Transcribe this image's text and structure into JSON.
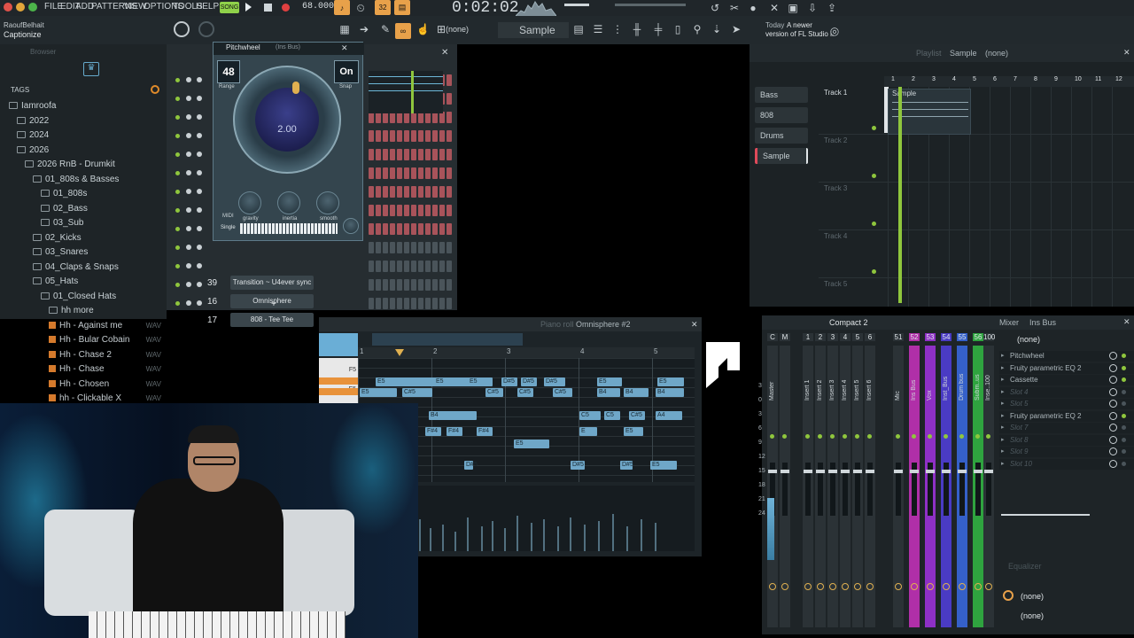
{
  "menu": [
    "FILE",
    "EDIT",
    "ADD",
    "PATTERNS",
    "VIEW",
    "OPTIONS",
    "TOOLS",
    "HELP"
  ],
  "transport": {
    "mode": "SONG",
    "tempo": "68.000",
    "time": "0:02:02",
    "step": "32"
  },
  "user": {
    "name": "RaoufBelhait",
    "sub": "Captionize"
  },
  "toolbar": {
    "preset": "(none)",
    "pattern": "Sample"
  },
  "news": {
    "line1": "Today",
    "line1b": "A newer",
    "line2": "version of FL Studio i."
  },
  "browser": {
    "search_placeholder": "Browser",
    "tags_label": "TAGS",
    "tree": [
      {
        "label": "Iamroofa",
        "level": 0,
        "type": "folder"
      },
      {
        "label": "2022",
        "level": 1,
        "type": "folder"
      },
      {
        "label": "2024",
        "level": 1,
        "type": "folder"
      },
      {
        "label": "2026",
        "level": 1,
        "type": "folder"
      },
      {
        "label": "2026 RnB - Drumkit",
        "level": 2,
        "type": "folder"
      },
      {
        "label": "01_808s & Basses",
        "level": 3,
        "type": "folder"
      },
      {
        "label": "01_808s",
        "level": 4,
        "type": "folder"
      },
      {
        "label": "02_Bass",
        "level": 4,
        "type": "folder"
      },
      {
        "label": "03_Sub",
        "level": 4,
        "type": "folder"
      },
      {
        "label": "02_Kicks",
        "level": 3,
        "type": "folder"
      },
      {
        "label": "03_Snares",
        "level": 3,
        "type": "folder"
      },
      {
        "label": "04_Claps & Snaps",
        "level": 3,
        "type": "folder"
      },
      {
        "label": "05_Hats",
        "level": 3,
        "type": "folder"
      },
      {
        "label": "01_Closed Hats",
        "level": 4,
        "type": "folder"
      },
      {
        "label": "hh more",
        "level": 5,
        "type": "folder"
      },
      {
        "label": "Hh - Against me",
        "level": 5,
        "type": "wav"
      },
      {
        "label": "Hh - Bular Cobain",
        "level": 5,
        "type": "wav"
      },
      {
        "label": "Hh - Chase 2",
        "level": 5,
        "type": "wav"
      },
      {
        "label": "Hh - Chase",
        "level": 5,
        "type": "wav"
      },
      {
        "label": "Hh - Chosen",
        "level": 5,
        "type": "wav"
      },
      {
        "label": "hh - Clickable X",
        "level": 5,
        "type": "wav"
      }
    ],
    "wav_tag": "WAV"
  },
  "pitchwheel": {
    "title": "Pitchwheel",
    "subtitle": "(Ins Bus)",
    "range_value": "48",
    "range_label": "Range",
    "snap_value": "On",
    "snap_label": "Snap",
    "center_value": "2.00",
    "knobs": [
      "gravity",
      "inertia",
      "smooth"
    ],
    "mode": "Single",
    "midi": "MIDI"
  },
  "channels": [
    {
      "num": "39",
      "name": "Transition ~ U4ever sync"
    },
    {
      "num": "16",
      "name": "Omnisphere"
    },
    {
      "num": "17",
      "name": "808 - Tee Tee"
    }
  ],
  "pianoroll": {
    "title": "Piano roll",
    "instrument": "Omnisphere #2",
    "bars": [
      "1",
      "2",
      "3",
      "4",
      "5"
    ],
    "keys": [
      "F5",
      "E5",
      "D5"
    ],
    "notes": [
      "E5",
      "E5",
      "E5",
      "D#5",
      "D#5",
      "D#5",
      "E5",
      "E5",
      "E5",
      "C#5",
      "C#5",
      "C#5",
      "C#5",
      "B4",
      "B4",
      "B4",
      "B4",
      "C5",
      "C5",
      "C#5",
      "A4",
      "A4",
      "G#4",
      "F#4",
      "F#4",
      "F#4",
      "E"
    ]
  },
  "playlist": {
    "title": "Playlist",
    "arrangement": "Sample",
    "pattern": "(none)",
    "patterns": [
      "Bass",
      "808",
      "Drums",
      "Sample"
    ],
    "tracks": [
      "Track 1",
      "Track 2",
      "Track 3",
      "Track 4",
      "Track 5"
    ],
    "clip_label": "Sample",
    "ruler": [
      "1",
      "2",
      "3",
      "4",
      "5",
      "6",
      "7",
      "8",
      "9",
      "10",
      "11",
      "12"
    ]
  },
  "mixer": {
    "title": "Mixer",
    "subtitle": "Ins Bus",
    "layout": "Compact 2",
    "preset": "(none)",
    "strips": [
      "C",
      "M",
      "1",
      "2",
      "3",
      "4",
      "5",
      "6",
      "51",
      "52",
      "53",
      "54",
      "55",
      "56",
      "100"
    ],
    "strip_names": [
      "Master",
      "Insert 1",
      "Insert 2",
      "Insert 3",
      "Insert 4",
      "Insert 5",
      "Insert 6",
      "Mic",
      "Ins Bus",
      "Vox",
      "Inst_Bus",
      "Drum bus",
      "Subm..us",
      "Inse..100"
    ],
    "scale": [
      "3",
      "0",
      "3",
      "6",
      "9",
      "12",
      "15",
      "18",
      "21",
      "24"
    ],
    "slots": [
      "Pitchwheel",
      "Fruity parametric EQ 2",
      "Cassette",
      "Slot 4",
      "Slot 5",
      "Fruity parametric EQ 2",
      "Slot 7",
      "Slot 8",
      "Slot 9",
      "Slot 10"
    ],
    "eq_label": "Equalizer",
    "out1": "(none)",
    "out2": "(none)"
  }
}
